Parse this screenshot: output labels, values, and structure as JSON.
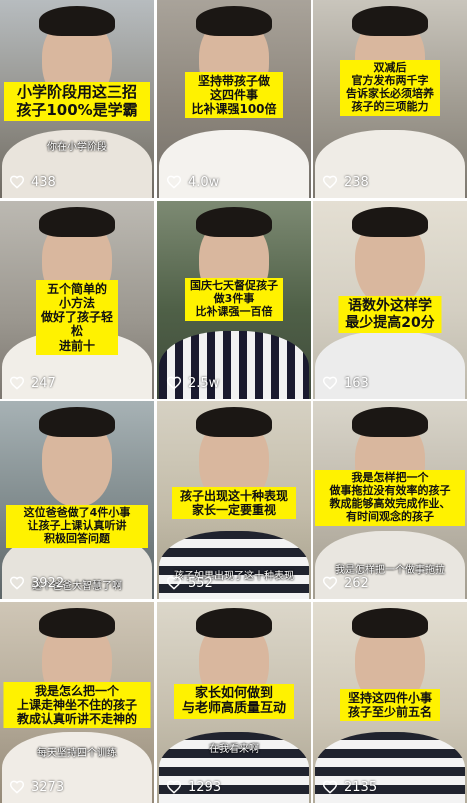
{
  "videos": [
    {
      "caption": "小学阶段用这三招\n孩子100%是学霸",
      "subtitle": "你在小学阶段",
      "likes": "438"
    },
    {
      "caption": "坚持带孩子做\n这四件事\n比补课强100倍",
      "subtitle": "",
      "likes": "4.0w"
    },
    {
      "caption": "双减后\n官方发布两千字\n告诉家长必须培养\n孩子的三项能力",
      "subtitle": "",
      "likes": "238"
    },
    {
      "caption": "五个简单的\n小方法\n做好了孩子轻松\n进前十",
      "subtitle": "",
      "likes": "247"
    },
    {
      "caption": "国庆七天督促孩子\n做3件事\n比补课强一百倍",
      "subtitle": "",
      "likes": "2.5w"
    },
    {
      "caption": "语数外这样学\n最少提高20分",
      "subtitle": "",
      "likes": "163"
    },
    {
      "caption": "这位爸爸做了4件小事\n让孩子上课认真听讲\n积极回答问题",
      "subtitle": "这个爸爸大智慧了啊",
      "likes": "3922"
    },
    {
      "caption": "孩子出现这十种表现\n家长一定要重视",
      "subtitle": "孩子如果出现了这十种表现",
      "likes": "552"
    },
    {
      "caption": "我是怎样把一个\n做事拖拉没有效率的孩子\n教成能够高效完成作业、\n有时间观念的孩子",
      "subtitle": "我是怎样把一个做事拖拉",
      "likes": "262"
    },
    {
      "caption": "我是怎么把一个\n上课走神坐不住的孩子\n教成认真听讲不走神的",
      "subtitle": "每天坚持四个训练",
      "likes": "3273"
    },
    {
      "caption": "家长如何做到\n与老师高质量互动",
      "subtitle": "在我看来啊",
      "likes": "1293"
    },
    {
      "caption": "坚持这四件小事\n孩子至少前五名",
      "subtitle": "",
      "likes": "2135"
    }
  ],
  "icons": {
    "likes": "heart-outline-icon"
  },
  "colors": {
    "caption_bg": "#fff200",
    "caption_text": "#111111",
    "overlay_text": "#ffffff"
  }
}
